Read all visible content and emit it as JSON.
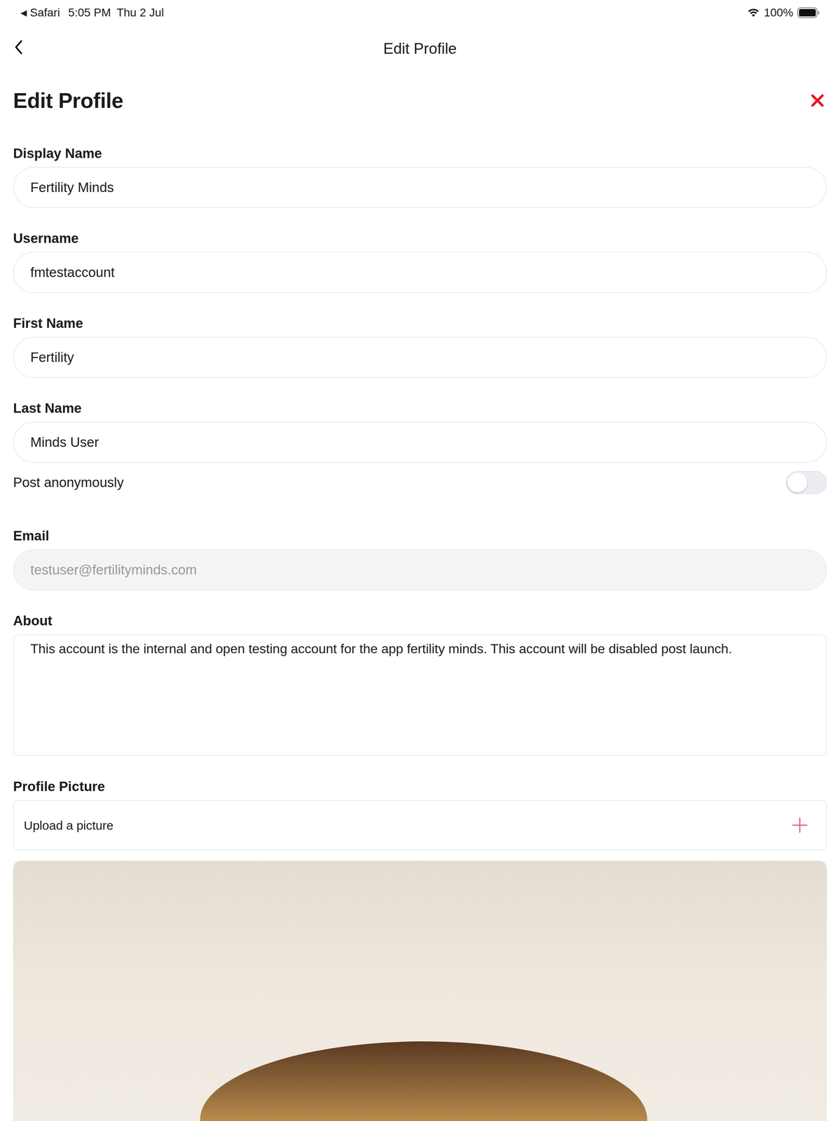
{
  "status_bar": {
    "back_glyph": "◀",
    "back_app": "Safari",
    "time": "5:05 PM",
    "date": "Thu 2 Jul",
    "battery": "100%"
  },
  "nav": {
    "title": "Edit Profile"
  },
  "heading": "Edit Profile",
  "form": {
    "items": [
      {
        "kind": "input",
        "label": "Display Name",
        "value": "Fertility Minds",
        "disabled": false
      },
      {
        "kind": "input",
        "label": "Username",
        "value": "fmtestaccount",
        "disabled": false
      },
      {
        "kind": "input",
        "label": "First Name",
        "value": "Fertility",
        "disabled": false
      },
      {
        "kind": "input",
        "label": "Last Name",
        "value": "Minds User",
        "disabled": false
      },
      {
        "kind": "toggle",
        "label": "Post anonymously",
        "on": false
      },
      {
        "kind": "input",
        "label": "Email",
        "value": "testuser@fertilityminds.com",
        "disabled": true
      },
      {
        "kind": "textarea",
        "label": "About",
        "value": "This account is the internal and open testing account for the app fertility minds. This account will be disabled post launch."
      },
      {
        "kind": "upload",
        "label": "Profile Picture",
        "button": "Upload a picture"
      }
    ]
  }
}
